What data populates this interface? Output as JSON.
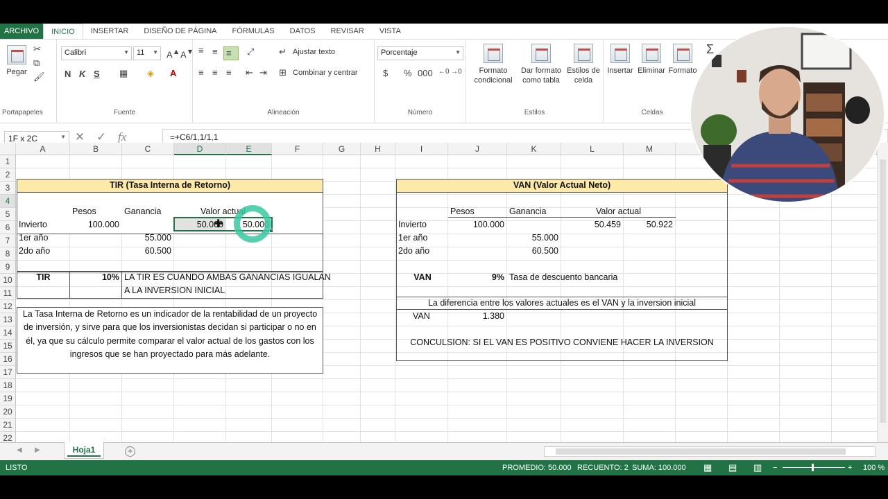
{
  "ribbon_tabs": [
    "ARCHIVO",
    "INICIO",
    "INSERTAR",
    "DISEÑO DE PÁGINA",
    "FÓRMULAS",
    "DATOS",
    "REVISAR",
    "VISTA"
  ],
  "ribbon": {
    "clipboard": {
      "paste": "Pegar",
      "label": "Portapapeles"
    },
    "font": {
      "name": "Calibri",
      "size": "11",
      "bold": "N",
      "italic": "K",
      "underline": "S",
      "label": "Fuente"
    },
    "alignment": {
      "wrap": "Ajustar texto",
      "merge": "Combinar y centrar",
      "label": "Alineación"
    },
    "number": {
      "format": "Porcentaje",
      "label": "Número"
    },
    "styles": {
      "conditional": "Formato condicional",
      "table": "Dar formato como tabla",
      "cell_styles": "Estilos de celda",
      "label": "Estilos"
    },
    "cells": {
      "insert": "Insertar",
      "delete": "Eliminar",
      "format": "Formato",
      "label": "Celdas"
    }
  },
  "formula_bar": {
    "name_box": "1F x 2C",
    "formula": "=+C6/1,1/1,1"
  },
  "columns": [
    "A",
    "B",
    "C",
    "D",
    "E",
    "F",
    "G",
    "H",
    "I",
    "J",
    "K",
    "L",
    "M"
  ],
  "rows": [
    "1",
    "2",
    "3",
    "4",
    "5",
    "6",
    "7",
    "8",
    "9",
    "10",
    "11",
    "12",
    "13",
    "14",
    "15",
    "16",
    "17",
    "18",
    "19",
    "20",
    "21",
    "22"
  ],
  "tir": {
    "title": "TIR (Tasa Interna de Retorno)",
    "h_pesos": "Pesos",
    "h_ganancia": "Ganancia",
    "h_valor": "Valor actual",
    "r4_label": "Invierto",
    "r4_pesos": "100.000",
    "r4_d": "50.000",
    "r4_e": "50.000",
    "r5_label": "1er año",
    "r5_gan": "55.000",
    "r6_label": "2do año",
    "r6_gan": "60.500",
    "tir_label": "TIR",
    "tir_value": "10%",
    "note1": "LA TIR ES CUANDO AMBAS GANANCIAS IGUALAN",
    "note2": "A LA INVERSION INICIAL",
    "description": "La Tasa Interna de Retorno es un indicador de la rentabilidad de un proyecto de inversión, y sirve para que los inversionistas decidan si participar o no en él, ya que su cálculo permite comparar el valor actual de los gastos con los ingresos que se han proyectado para más adelante."
  },
  "van": {
    "title": "VAN (Valor Actual Neto)",
    "h_pesos": "Pesos",
    "h_ganancia": "Ganancia",
    "h_valor": "Valor actual",
    "r4_label": "Invierto",
    "r4_pesos": "100.000",
    "r4_l": "50.459",
    "r4_m": "50.922",
    "r5_label": "1er año",
    "r5_gan": "55.000",
    "r6_label": "2do año",
    "r6_gan": "60.500",
    "van_label": "VAN",
    "van_rate": "9%",
    "rate_text": "Tasa de descuento bancaria",
    "diff_text": "La diferencia entre  los valores actuales es el VAN y la inversion inicial",
    "van2_label": "VAN",
    "van2_value": "1.380",
    "conclusion": "CONCULSION: SI EL VAN ES POSITIVO CONVIENE HACER LA INVERSION"
  },
  "sheet_tab": "Hoja1",
  "status": {
    "mode": "LISTO",
    "average": "PROMEDIO: 50.000",
    "count": "RECUENTO: 2",
    "sum": "SUMA: 100.000",
    "zoom": "100 %"
  }
}
